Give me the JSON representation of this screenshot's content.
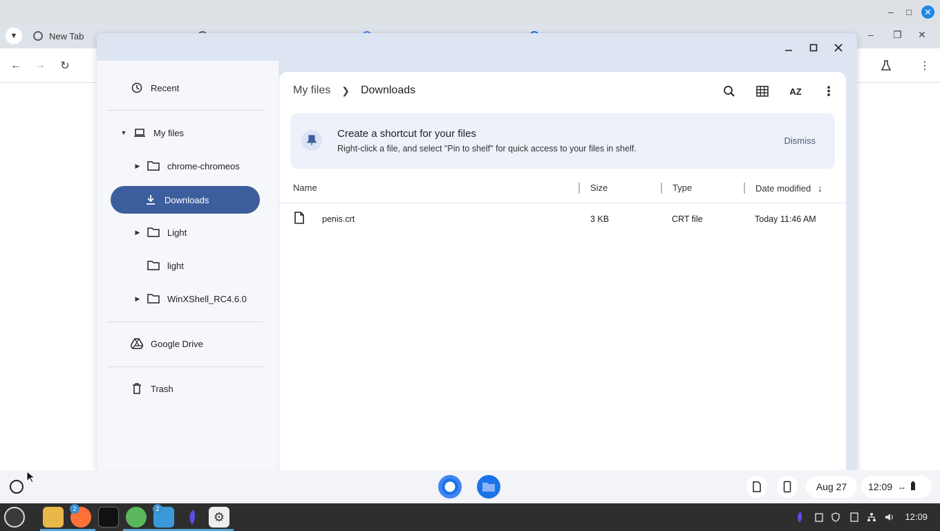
{
  "browser": {
    "tabs": [
      {
        "label": "New Tab"
      },
      {
        "label": ""
      },
      {
        "label": ""
      },
      {
        "label": ""
      }
    ]
  },
  "files_app": {
    "sidebar": {
      "recent": "Recent",
      "my_files": "My files",
      "folders": [
        "chrome-chromeos",
        "Downloads",
        "Light",
        "light",
        "WinXShell_RC4.6.0"
      ],
      "google_drive": "Google Drive",
      "trash": "Trash"
    },
    "breadcrumb": {
      "parent": "My files",
      "current": "Downloads"
    },
    "toolbar": {
      "sort_label": "AZ"
    },
    "banner": {
      "title": "Create a shortcut for your files",
      "text": "Right-click a file, and select \"Pin to shelf\" for quick access to your files in shelf.",
      "dismiss": "Dismiss"
    },
    "columns": {
      "name": "Name",
      "size": "Size",
      "type": "Type",
      "date": "Date modified"
    },
    "files": [
      {
        "name": "penis.crt",
        "size": "3 KB",
        "type": "CRT file",
        "date": "Today 11:46 AM"
      }
    ]
  },
  "shelf": {
    "date": "Aug 27",
    "time": "12:09"
  },
  "panel": {
    "clock": "12:09",
    "badge_firefox": "2",
    "badge_files": "2"
  },
  "colors": {
    "accent": "#3d5e9c",
    "host_close": "#1e88e5"
  }
}
